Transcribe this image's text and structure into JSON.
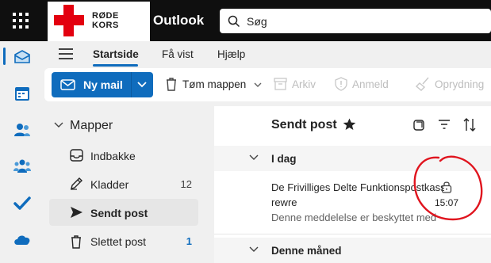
{
  "header": {
    "brand_line1": "RØDE",
    "brand_line2": "KORS",
    "app_name": "Outlook",
    "search_placeholder": "Søg"
  },
  "rail": {
    "icons": [
      "mail-icon",
      "calendar-icon",
      "people-icon",
      "groups-icon",
      "todo-icon",
      "onedrive-icon"
    ]
  },
  "ribbon": {
    "tabs": [
      {
        "label": "Startside",
        "active": true
      },
      {
        "label": "Få vist",
        "active": false
      },
      {
        "label": "Hjælp",
        "active": false
      }
    ],
    "new_mail": "Ny mail",
    "empty_folder": "Tøm mappen",
    "archive": "Arkiv",
    "report": "Anmeld",
    "sweep": "Oprydning"
  },
  "folders": {
    "title": "Mapper",
    "items": [
      {
        "name": "Indbakke",
        "count": "",
        "selected": false
      },
      {
        "name": "Kladder",
        "count": "12",
        "selected": false
      },
      {
        "name": "Sendt post",
        "count": "",
        "selected": true
      },
      {
        "name": "Slettet post",
        "count": "1",
        "selected": false
      }
    ]
  },
  "message_list": {
    "title": "Sendt post",
    "groups": [
      "I dag",
      "Denne måned"
    ],
    "messages": [
      {
        "from": "De Frivilliges Delte Funktionspostkasse",
        "subject": "rewre",
        "preview": "Denne meddelelse er beskyttet med",
        "time": "15:07"
      }
    ]
  },
  "colors": {
    "accent": "#0f6cbd",
    "brand_red": "#e3000f",
    "annotation": "#e0141e"
  }
}
